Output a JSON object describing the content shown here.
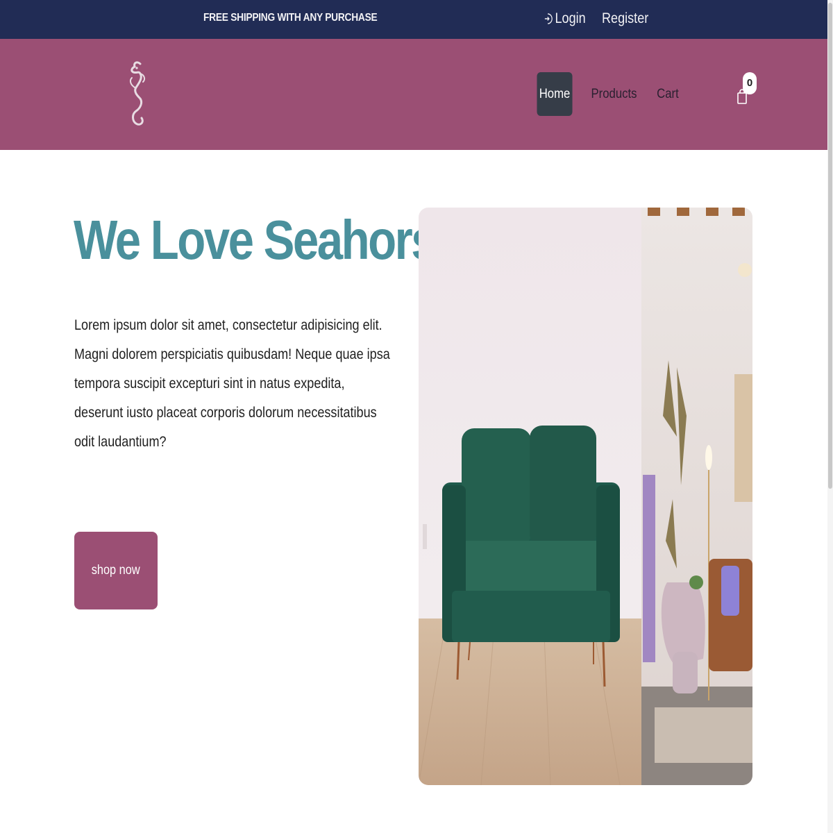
{
  "colors": {
    "topbar": "#212c55",
    "header": "#9b4f74",
    "accent_title": "#4a909c",
    "nav_active": "#363d48",
    "button": "#9b4f74"
  },
  "topbar": {
    "promo": "FREE SHIPPING WITH ANY PURCHASE",
    "login_label": "Login",
    "register_label": "Register",
    "login_icon": "sign-in-icon"
  },
  "header": {
    "logo": "seahorse-logo",
    "nav": [
      {
        "label": "Home",
        "active": true
      },
      {
        "label": "Products",
        "active": false
      },
      {
        "label": "Cart",
        "active": false
      }
    ],
    "cart_icon": "shopping-bag-icon",
    "cart_count": "0"
  },
  "hero": {
    "title": "We Love Seahorse",
    "text": "Lorem ipsum dolor sit amet, consectetur adipisicing elit. Magni dolorem perspiciatis quibusdam! Neque quae ipsa tempora suscipit excepturi sint in natus expedita, deserunt iusto placeat corporis dolorum necessitatibus odit laudantium?",
    "button_label": "shop now",
    "image": "green-armchair-photo"
  }
}
